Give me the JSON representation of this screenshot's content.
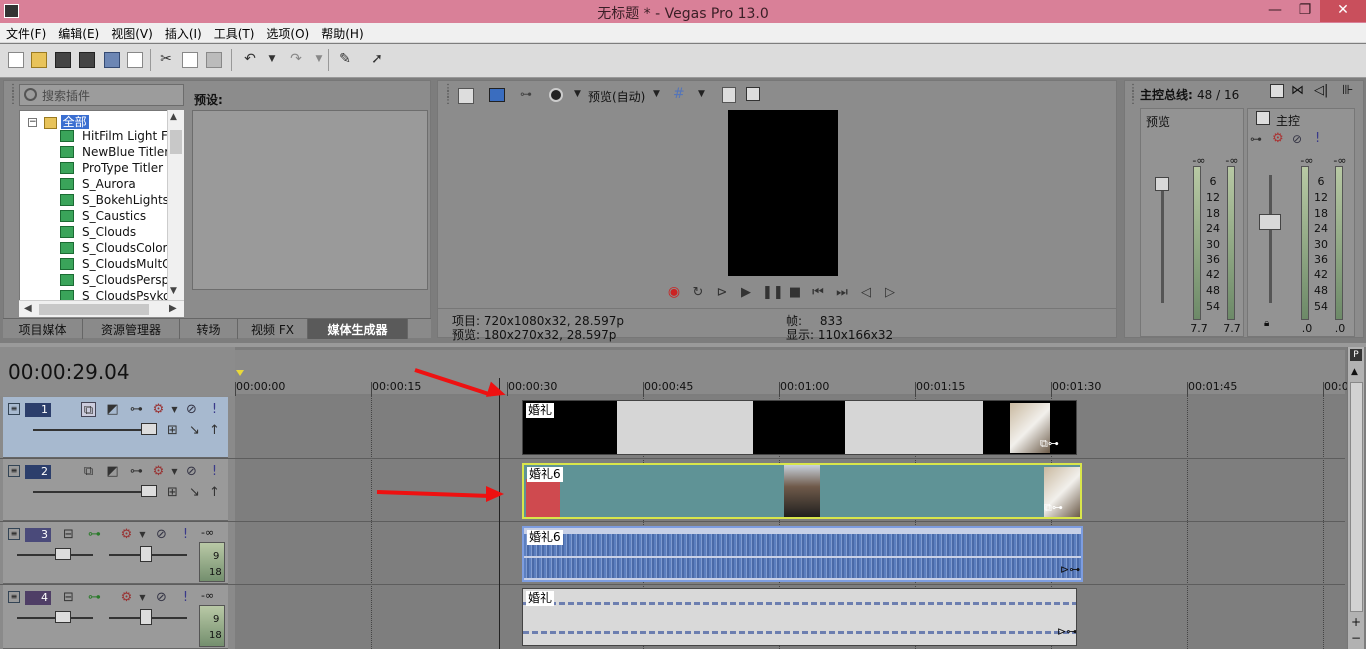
{
  "window": {
    "title": "无标题 * - Vegas Pro 13.0",
    "minimize_glyph": "—",
    "restore_glyph": "❐",
    "close_glyph": "✕"
  },
  "menu": [
    "文件(F)",
    "编辑(E)",
    "视图(V)",
    "插入(I)",
    "工具(T)",
    "选项(O)",
    "帮助(H)"
  ],
  "plugins": {
    "search_placeholder": "搜索插件",
    "preset_label": "预设:",
    "root": "全部",
    "items": [
      "HitFilm Light Fla",
      "NewBlue Titler F",
      "ProType Titler",
      "S_Aurora",
      "S_BokehLights",
      "S_Caustics",
      "S_Clouds",
      "S_CloudsColorS",
      "S_CloudsMultCo",
      "S_CloudsPerspe",
      "S_CloudsPsyko"
    ],
    "tabs": [
      "项目媒体",
      "资源管理器",
      "转场",
      "视频 FX",
      "媒体生成器"
    ],
    "active_tab": 4
  },
  "preview": {
    "mode_label": "预览(自动)",
    "project_label": "项目:",
    "project_value": "720x1080x32, 28.597p",
    "preview_label": "预览:",
    "preview_value": "180x270x32, 28.597p",
    "frame_label": "帧:",
    "frame_value": "833",
    "display_label": "显示:",
    "display_value": "110x166x32"
  },
  "mixer": {
    "title": "主控总线:",
    "count": "48 / 16",
    "preview_label": "预览",
    "master_label": "主控",
    "ticks": [
      "-∞",
      "6",
      "12",
      "18",
      "24",
      "30",
      "36",
      "42",
      "48",
      "54"
    ],
    "left_values": [
      "7.7",
      "7.7"
    ],
    "right_values": [
      ".0",
      ".0"
    ]
  },
  "timeline": {
    "timecode": "00:00:29.04",
    "ruler": [
      "00:00:00",
      "00:00:15",
      "00:00:30",
      "00:00:45",
      "00:01:00",
      "00:01:15",
      "00:01:30",
      "00:01:45",
      "00:0"
    ],
    "tracks": [
      {
        "num": "1",
        "type": "video"
      },
      {
        "num": "2",
        "type": "video"
      },
      {
        "num": "3",
        "type": "audio",
        "vol": "-∞",
        "meter_a": "9",
        "meter_b": "18"
      },
      {
        "num": "4",
        "type": "audio",
        "vol": "-∞",
        "meter_a": "9",
        "meter_b": "18"
      }
    ],
    "clips": {
      "track1": "婚礼",
      "track2": "婚礼6",
      "track3": "婚礼6",
      "track4": "婚礼"
    }
  },
  "colors": {
    "titlebar": "#d98098",
    "clip_teal": "#5f9396",
    "clip_red": "#cf4a4f",
    "audio_wave": "#5c7fbf",
    "arrow": "#e11111"
  }
}
